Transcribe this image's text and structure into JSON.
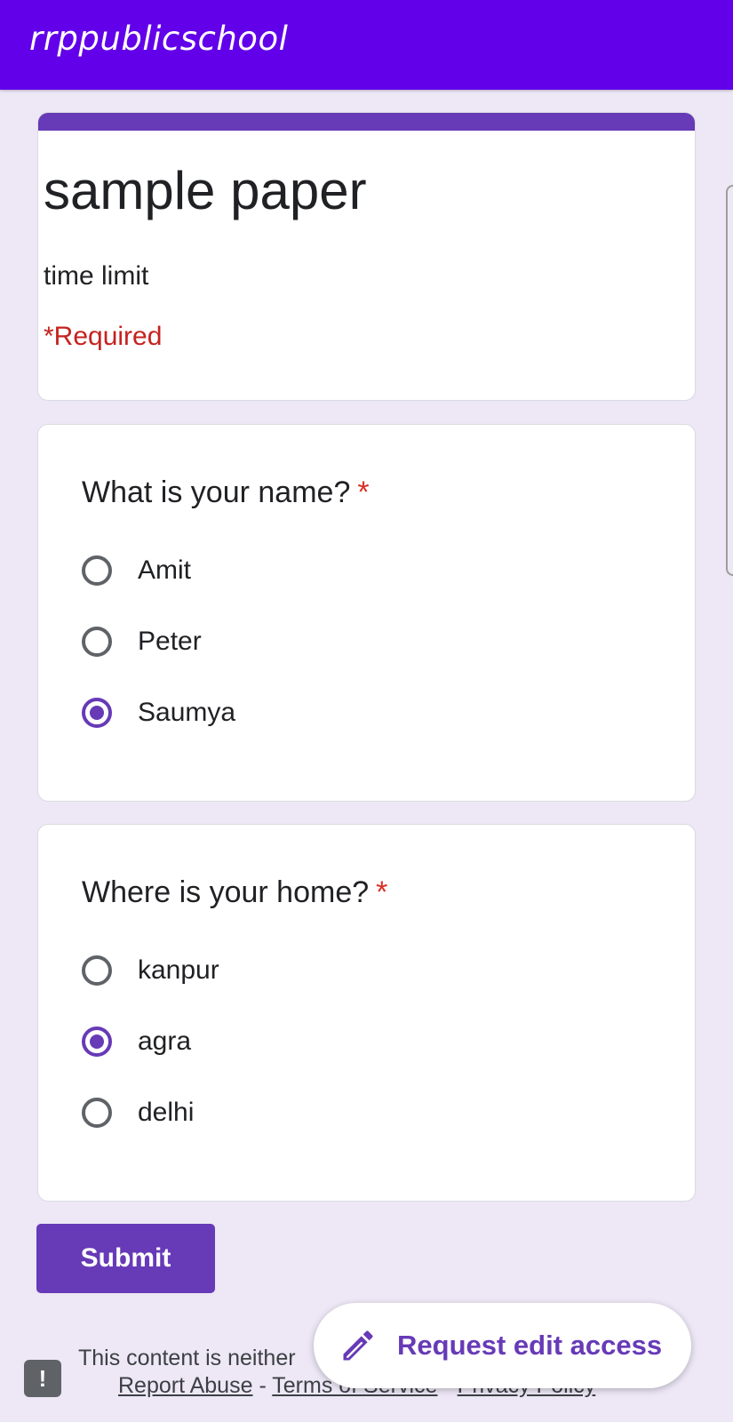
{
  "app": {
    "brand": "rrppublicschool"
  },
  "form": {
    "title": "sample paper",
    "description": "time limit",
    "required_note": "*Required"
  },
  "questions": [
    {
      "title": "What is your name?",
      "required_marker": "*",
      "options": [
        {
          "label": "Amit",
          "selected": false
        },
        {
          "label": "Peter",
          "selected": false
        },
        {
          "label": "Saumya",
          "selected": true
        }
      ]
    },
    {
      "title": "Where is your home?",
      "required_marker": "*",
      "options": [
        {
          "label": "kanpur",
          "selected": false
        },
        {
          "label": "agra",
          "selected": true
        },
        {
          "label": "delhi",
          "selected": false
        }
      ]
    }
  ],
  "actions": {
    "submit_label": "Submit",
    "request_edit_label": "Request edit access"
  },
  "footer": {
    "notice": "This content is neither",
    "report_abuse": "Report Abuse",
    "terms": "Terms of Service",
    "privacy": "Privacy Policy",
    "separator": " - "
  },
  "icons": {
    "feedback": "feedback-icon",
    "edit": "pencil-icon"
  },
  "colors": {
    "header_bar": "#6200ea",
    "accent": "#673ab7",
    "required": "#c5221f",
    "page_bg": "#ede7f6"
  }
}
